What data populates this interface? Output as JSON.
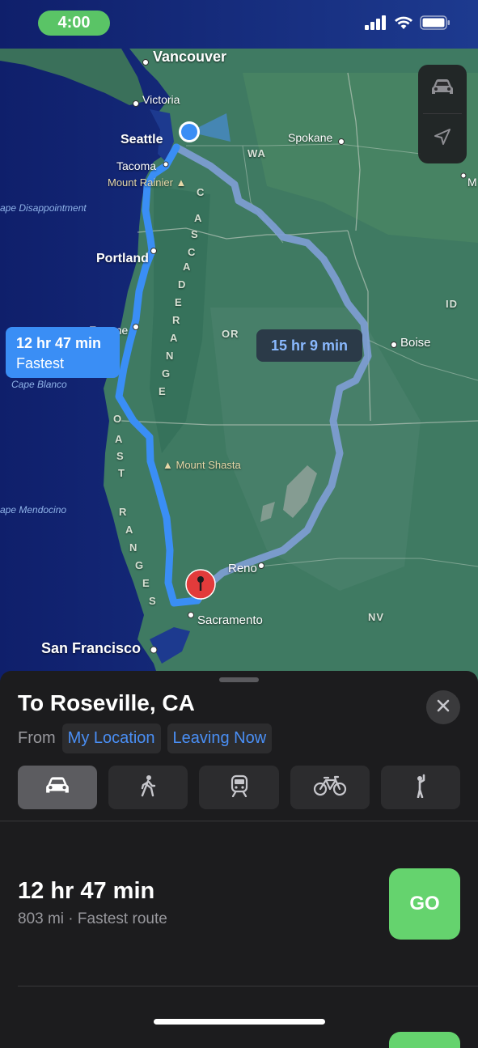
{
  "status": {
    "time": "4:00"
  },
  "map": {
    "cities": {
      "vancouver": "Vancouver",
      "victoria": "Victoria",
      "seattle": "Seattle",
      "tacoma": "Tacoma",
      "spokane": "Spokane",
      "portland": "Portland",
      "eugene": "Eugene",
      "boise": "Boise",
      "reno": "Reno",
      "sacramento": "Sacramento",
      "san_francisco": "San Francisco",
      "m_partial": "M"
    },
    "states": {
      "wa": "WA",
      "or": "OR",
      "id": "ID",
      "nv": "NV"
    },
    "water": {
      "cape_disappointment": "ape Disappointment",
      "cape_blanco": "Cape Blanco",
      "cape_mendocino": "ape Mendocino"
    },
    "peaks": {
      "rainier": "Mount Rainier",
      "shasta": "Mount Shasta"
    },
    "cascade_range_letters": [
      "C",
      "A",
      "S",
      "C",
      "A",
      "D",
      "E",
      "R",
      "A",
      "N",
      "G",
      "E"
    ],
    "coast_range_letters": [
      "O",
      "A",
      "S",
      "T",
      "R",
      "A",
      "N",
      "G",
      "E",
      "S"
    ]
  },
  "routes": {
    "fastest": {
      "duration": "12 hr 47 min",
      "label": "Fastest"
    },
    "alternate": {
      "duration": "15 hr 9 min"
    }
  },
  "sheet": {
    "destination": "To Roseville, CA",
    "from_label": "From",
    "origin": "My Location",
    "departure": "Leaving Now",
    "modes": [
      "drive",
      "walk",
      "transit",
      "cycle",
      "rideshare"
    ],
    "selected_mode": "drive",
    "route": {
      "duration": "12 hr 47 min",
      "details": "803 mi · Fastest route",
      "go_label": "GO"
    }
  },
  "colors": {
    "route_primary": "#3a8ef5",
    "route_alternate": "#7f9fd6",
    "go_green": "#65d36e",
    "time_pill": "#5ac466",
    "link_blue": "#4a8ff5"
  }
}
